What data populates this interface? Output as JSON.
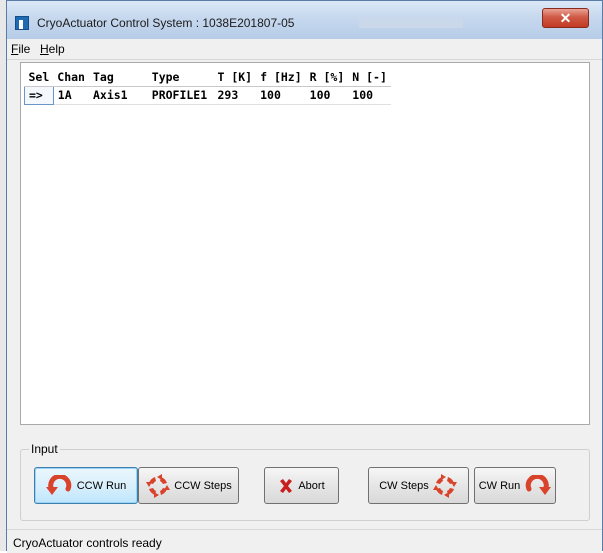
{
  "window": {
    "title": "CryoActuator Control System : 1038E201807-05",
    "close_label": "✕"
  },
  "menu": {
    "items": [
      {
        "label": "File",
        "accel": "F"
      },
      {
        "label": "Help",
        "accel": "H"
      }
    ]
  },
  "table": {
    "headers": [
      "Sel",
      "Chan",
      "Tag",
      "Type",
      "T [K]",
      "f [Hz]",
      "R [%]",
      "N [-]"
    ],
    "rows": [
      {
        "sel": "=>",
        "chan": "1A",
        "tag": "Axis1",
        "type": "PROFILE1",
        "t": "293",
        "f": "100",
        "r": "100",
        "n": "100"
      }
    ]
  },
  "input": {
    "group_label": "Input",
    "buttons": {
      "ccw_run": "CCW Run",
      "ccw_steps": "CCW Steps",
      "abort": "Abort",
      "cw_steps": "CW Steps",
      "cw_run": "CW Run"
    }
  },
  "status": {
    "text": "CryoActuator controls ready"
  },
  "colors": {
    "arrow_red": "#d9432b",
    "abort_red": "#c81e1e",
    "accent_blue": "#1f6bb3"
  }
}
